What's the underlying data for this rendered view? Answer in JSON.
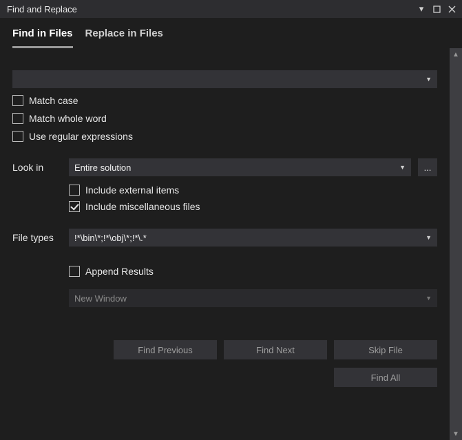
{
  "titlebar": {
    "title": "Find and Replace"
  },
  "tabs": {
    "find_in_files": "Find in Files",
    "replace_in_files": "Replace in Files"
  },
  "search": {
    "value": ""
  },
  "options": {
    "match_case": "Match case",
    "match_whole_word": "Match whole word",
    "use_regex": "Use regular expressions"
  },
  "look_in": {
    "label": "Look in",
    "selected": "Entire solution",
    "include_external": "Include external items",
    "include_misc": "Include miscellaneous files"
  },
  "file_types": {
    "label": "File types",
    "value": "!*\\bin\\*;!*\\obj\\*;!*\\.*"
  },
  "results": {
    "append": "Append Results",
    "destination": "New Window"
  },
  "buttons": {
    "find_previous": "Find Previous",
    "find_next": "Find Next",
    "skip_file": "Skip File",
    "find_all": "Find All"
  }
}
